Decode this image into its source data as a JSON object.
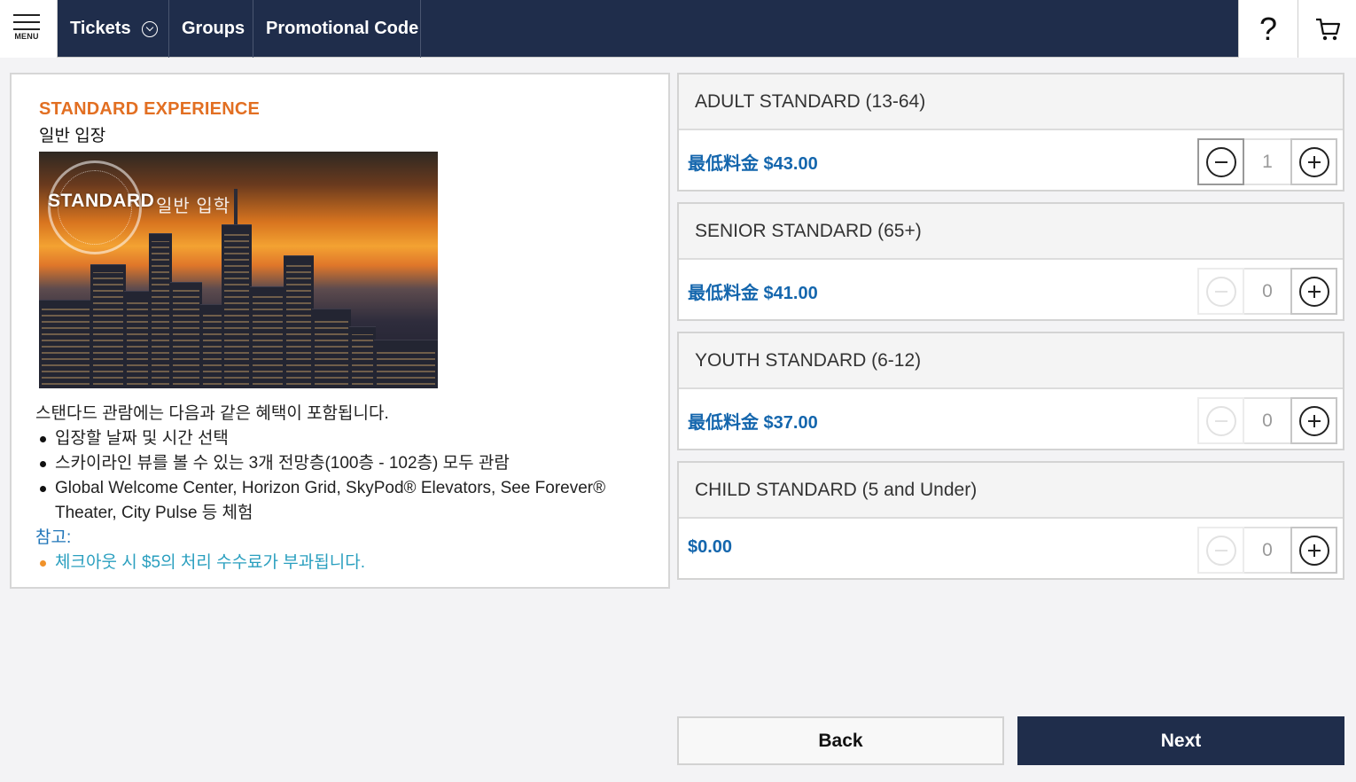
{
  "header": {
    "menu_label": "MENU",
    "tabs": [
      {
        "label": "Tickets"
      },
      {
        "label": "Groups"
      },
      {
        "label": "Promotional Code"
      }
    ],
    "help_label": "?",
    "colors": {
      "bar": "#1f2d4b",
      "accent_orange": "#e26f22",
      "price_blue": "#1466ad"
    }
  },
  "experience": {
    "title": "STANDARD EXPERIENCE",
    "subtitle": "일반 입장",
    "image": {
      "badge_text": "STANDARD",
      "overlay_text": "일반 입학"
    },
    "intro": "스탠다드 관람에는 다음과 같은 혜택이 포함됩니다.",
    "benefits": [
      "입장할 날짜 및 시간 선택",
      "스카이라인 뷰를 볼 수 있는 3개 전망층(100층 - 102층) 모두 관람",
      "Global Welcome Center, Horizon Grid, SkyPod® Elevators, See Forever® Theater, City Pulse 등 체험"
    ],
    "note_label": "참고:",
    "notes": [
      "체크아웃 시 $5의 처리 수수료가 부과됩니다."
    ]
  },
  "tickets": [
    {
      "name": "ADULT STANDARD (13-64)",
      "price": "最低料金 $43.00",
      "quantity": "1",
      "minus_enabled": true
    },
    {
      "name": "SENIOR STANDARD (65+)",
      "price": "最低料金 $41.00",
      "quantity": "0",
      "minus_enabled": false
    },
    {
      "name": "YOUTH STANDARD (6-12)",
      "price": "最低料金 $37.00",
      "quantity": "0",
      "minus_enabled": false
    },
    {
      "name": "CHILD STANDARD (5 and Under)",
      "price": "$0.00",
      "quantity": "0",
      "minus_enabled": false
    }
  ],
  "actions": {
    "back_label": "Back",
    "next_label": "Next"
  }
}
